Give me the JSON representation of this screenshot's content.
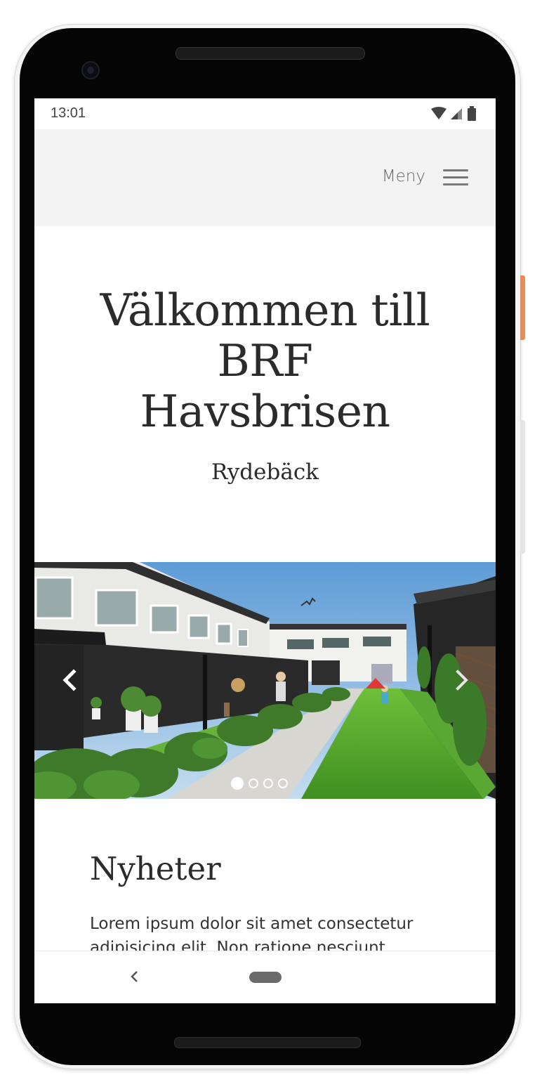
{
  "status_bar": {
    "time": "13:01",
    "icons": [
      "wifi-icon",
      "signal-icon",
      "battery-icon"
    ]
  },
  "header": {
    "menu_label": "Meny",
    "menu_icon": "hamburger-icon"
  },
  "hero": {
    "title_line1": "Välkommen till",
    "title_line2": "BRF",
    "title_line3": "Havsbrisen",
    "subtitle": "Rydebäck"
  },
  "carousel": {
    "prev_icon": "chevron-left-icon",
    "next_icon": "chevron-right-icon",
    "slide_count": 4,
    "active_slide": 1
  },
  "news": {
    "title": "Nyheter",
    "text": "Lorem ipsum dolor sit amet consectetur adipisicing elit. Non ratione nesciunt"
  },
  "nav_bar": {
    "back_icon": "back-chevron-icon",
    "home_icon": "home-pill-icon"
  },
  "colors": {
    "header_bg": "#f3f3f3",
    "text": "#2b2b2b",
    "accent_button": "#f08a54"
  }
}
